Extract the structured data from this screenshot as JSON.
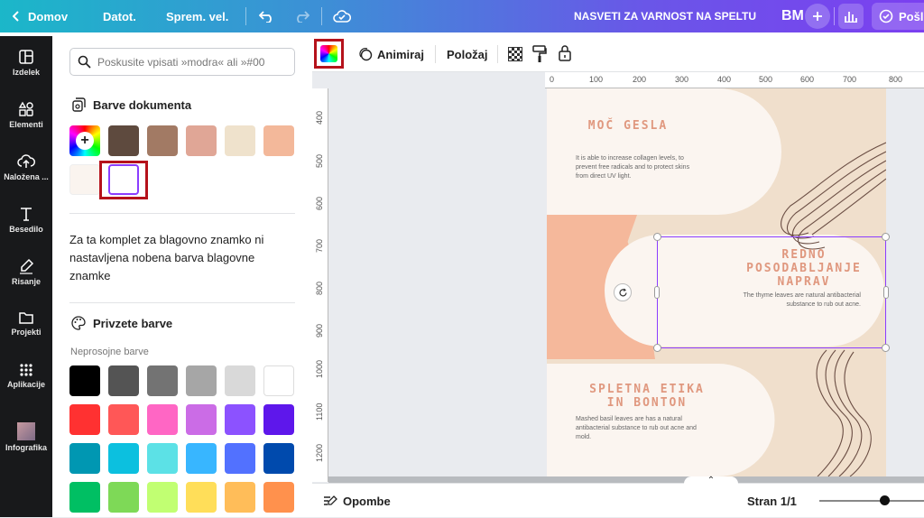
{
  "topbar": {
    "back_label": "Domov",
    "file_label": "Datot.",
    "resize_label": "Sprem. vel.",
    "doc_title": "NASVETI ZA VARNOST NA SPELTU",
    "avatar_initials": "BM",
    "share_label": "Pošl"
  },
  "sidebar": {
    "items": [
      {
        "label": "Izdelek",
        "icon": "layout-icon"
      },
      {
        "label": "Elementi",
        "icon": "shapes-icon"
      },
      {
        "label": "Naložena ...",
        "icon": "cloud-upload-icon"
      },
      {
        "label": "Besedilo",
        "icon": "text-icon"
      },
      {
        "label": "Risanje",
        "icon": "pen-icon"
      },
      {
        "label": "Projekti",
        "icon": "folder-icon"
      },
      {
        "label": "Aplikacije",
        "icon": "grid-icon"
      },
      {
        "label": "Infografika",
        "icon": "thumbnail"
      }
    ]
  },
  "panel": {
    "search_placeholder": "Poskusite vpisati »modra« ali »#00",
    "doc_colors_title": "Barve dokumenta",
    "doc_colors": [
      "#5e4a3e",
      "#a27a64",
      "#e0a696",
      "#efe2cc",
      "#f3b89a",
      "#faf4ef",
      "#ffffff"
    ],
    "brand_note": "Za ta komplet za blagovno znamko ni nastavljena nobena barva blagovne znamke",
    "default_colors_title": "Privzete barve",
    "solid_label": "Neprosojne barve",
    "solid_colors": [
      [
        "#000000",
        "#545454",
        "#737373",
        "#a6a6a6",
        "#d9d9d9",
        "#ffffff"
      ],
      [
        "#ff3131",
        "#ff5757",
        "#ff66c4",
        "#cb6ce6",
        "#8c52ff",
        "#5e17eb"
      ],
      [
        "#0097b2",
        "#0cc0df",
        "#5ce1e6",
        "#38b6ff",
        "#5271ff",
        "#004aad"
      ],
      [
        "#00bf63",
        "#7ed957",
        "#c1ff72",
        "#ffde59",
        "#ffbd59",
        "#ff914d"
      ]
    ]
  },
  "toolbar": {
    "animate_label": "Animiraj",
    "position_label": "Položaj"
  },
  "ruler": {
    "h_ticks": [
      "0",
      "100",
      "200",
      "300",
      "400",
      "500",
      "600",
      "700",
      "800"
    ],
    "v_ticks": [
      "400",
      "500",
      "600",
      "700",
      "800",
      "900",
      "1000",
      "1100",
      "1200"
    ]
  },
  "design": {
    "h1": "MOČ GESLA",
    "b1": "It is able to increase collagen levels, to prevent free radicals and to protect skins from direct UV light.",
    "h2": "REDNO POSODABLJANJE NAPRAV",
    "b2": "The thyme leaves are natural antibacterial substance to rub out acne.",
    "h3": "SPLETNA ETIKA IN BONTON",
    "b3": "Mashed basil leaves are has a natural antibacterial substance to rub out acne and mold."
  },
  "bottombar": {
    "notes_label": "Opombe",
    "page_label": "Stran 1/1"
  }
}
